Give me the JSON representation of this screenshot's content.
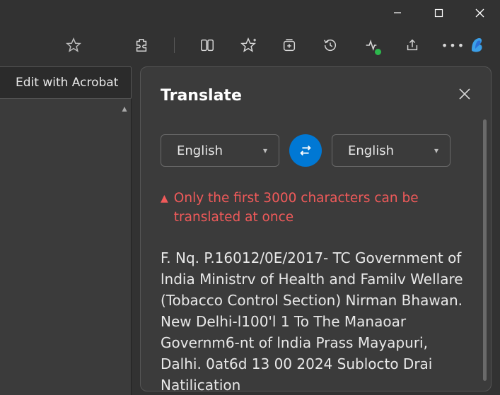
{
  "acrobat_tab_label": "Edit with Acrobat",
  "panel": {
    "title": "Translate",
    "lang_from": "English",
    "lang_to": "English",
    "warning": "Only the first 3000 characters can be translated at once",
    "translated_text": "F. Nq. P.16012/0E/2017- TC Government of lndia Ministrv of Health and Familv Wellare (Tobacco Control Section) Nirman Bhawan. New Delhi-l100'l 1 To The Manaoar Governm6-nt of lndia Prass Mayapuri, Dalhi. 0at6d 13 00 2024 Sublocto Drai Natilication"
  }
}
